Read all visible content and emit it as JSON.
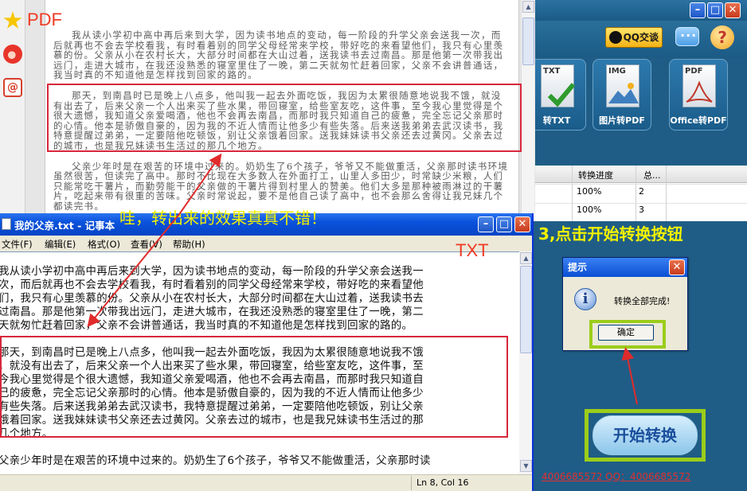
{
  "pdf_viewer": {
    "label": "PDF",
    "paragraphs": [
      "我从读小学初中高中再后来到大学，因为读书地点的变动，每一阶段的升学父亲会送我一次，而后就再也不会去学校看我，有时看着别的同学父母经常来学校，带好吃的来看望他们，我只有心里羡慕的份。父亲从小在农村长大，大部分时间都在大山过着，送我读书去过南昌。那是他第一次带我出远门，走进大城市，在我还没熟悉的寝室里住了一晚，第二天就匆忙赶着回家，父亲不会讲普通话，我当时真的不知道他是怎样找到回家的路的。",
      "那天，到南昌时已是晚上八点多，他叫我一起去外面吃饭，我因为太累很随意地说我不饿，就没有出去了，后来父亲一个人出来买了些水果，带回寝室，给些室友吃，这件事，至今我心里觉得是个很大遗憾，我知道父亲爱喝酒，他也不会再去南昌，而那时我只知道自己的疲惫，完全忘记父亲那时的心情。他本是骄傲自豪的，因为我的不近人情而让他多少有些失落。后来送我弟弟去武汉读书，我特意提醒过弟弟，一定要陪他吃顿饭，别让父亲饿着回家。送我妹妹读书父亲还去过黄冈。父亲去过的城市，也是我兄妹读书生活过的那几个地方。",
      "父亲少年时是在艰苦的环境中过来的。奶奶生了6个孩子，爷爷又不能做重活，父亲那时读书环境虽然很苦，但读完了高中。那时不比现在大多数人在外面打工，山里人多田少，时常缺少米粮，人们只能常吃干薯片，而勤劳能干的父亲做的干薯片得到村里人的赞美。他们大多是那种被雨淋过的干薯片，吃起来带有很重的苦味。父亲时常说起，要不是他自己读了高中，也不会那么舍得让我兄妹几个都读完书。"
    ]
  },
  "converter": {
    "qq_button": "QQ交谈",
    "help_glyph": "?",
    "cards": [
      {
        "ext": "TXT",
        "label": "转TXT"
      },
      {
        "ext": "IMG",
        "label": "图片转PDF"
      },
      {
        "ext": "PDF",
        "label": "Office转PDF"
      }
    ],
    "table": {
      "headers": [
        "转换进度",
        "总..."
      ],
      "rows": [
        {
          "progress": "100%",
          "total": "2"
        },
        {
          "progress": "100%",
          "total": "3"
        }
      ]
    },
    "step_text": "3,点击开始转换按钮",
    "start_button": "开始转换",
    "contact": "4006685572 QQ：4006685572"
  },
  "dialog": {
    "title": "提示",
    "message": "转换全部完成!",
    "ok": "确定",
    "info_glyph": "i"
  },
  "notepad": {
    "title": "我的父亲.txt - 记事本",
    "menu": [
      "文件(F)",
      "编辑(E)",
      "格式(O)",
      "查看(V)",
      "帮助(H)"
    ],
    "lines_p1": [
      "我从读小学初中高中再后来到大学，因为读书地点的变动，每一阶段的升学父亲会送我一",
      "次，而后就再也不会去学校看我，有时看着别的同学父母经常来学校，带好吃的来看望他",
      "们，我只有心里羡慕的份。父亲从小在农村长大，大部分时间都在大山过着，送我读书去",
      "过南昌。那是他第一次带我出远门，走进大城市，在我还没熟悉的寝室里住了一晚，第二",
      "天就匆忙赶着回家，父亲不会讲普通话，我当时真的不知道他是怎样找到回家的路的。"
    ],
    "lines_p2": [
      "那天，到南昌时已是晚上八点多，他叫我一起去外面吃饭，我因为太累很随意地说我不饿",
      "，就没有出去了，后来父亲一个人出来买了些水果，带回寝室，给些室友吃，这件事，至",
      "今我心里觉得是个很大遗憾，我知道父亲爱喝酒，他也不会再去南昌，而那时我只知道自",
      "己的疲惫，完全忘记父亲那时的心情。他本是骄傲自豪的，因为我的不近人情而让他多少",
      "有些失落。后来送我弟弟去武汉读书，我特意提醒过弟弟，一定要陪他吃顿饭，别让父亲",
      "饿着回家。送我妹妹读书父亲还去过黄冈。父亲去过的城市，也是我兄妹读书生活过的那",
      "几个地方。"
    ],
    "lines_p3": [
      "父亲少年时是在艰苦的环境中过来的。奶奶生了6个孩子，爷爷又不能做重活，父亲那时读"
    ],
    "status": "Ln 8, Col 16",
    "label": "TXT",
    "caption": "哇，转出来的效果真真不错！"
  }
}
